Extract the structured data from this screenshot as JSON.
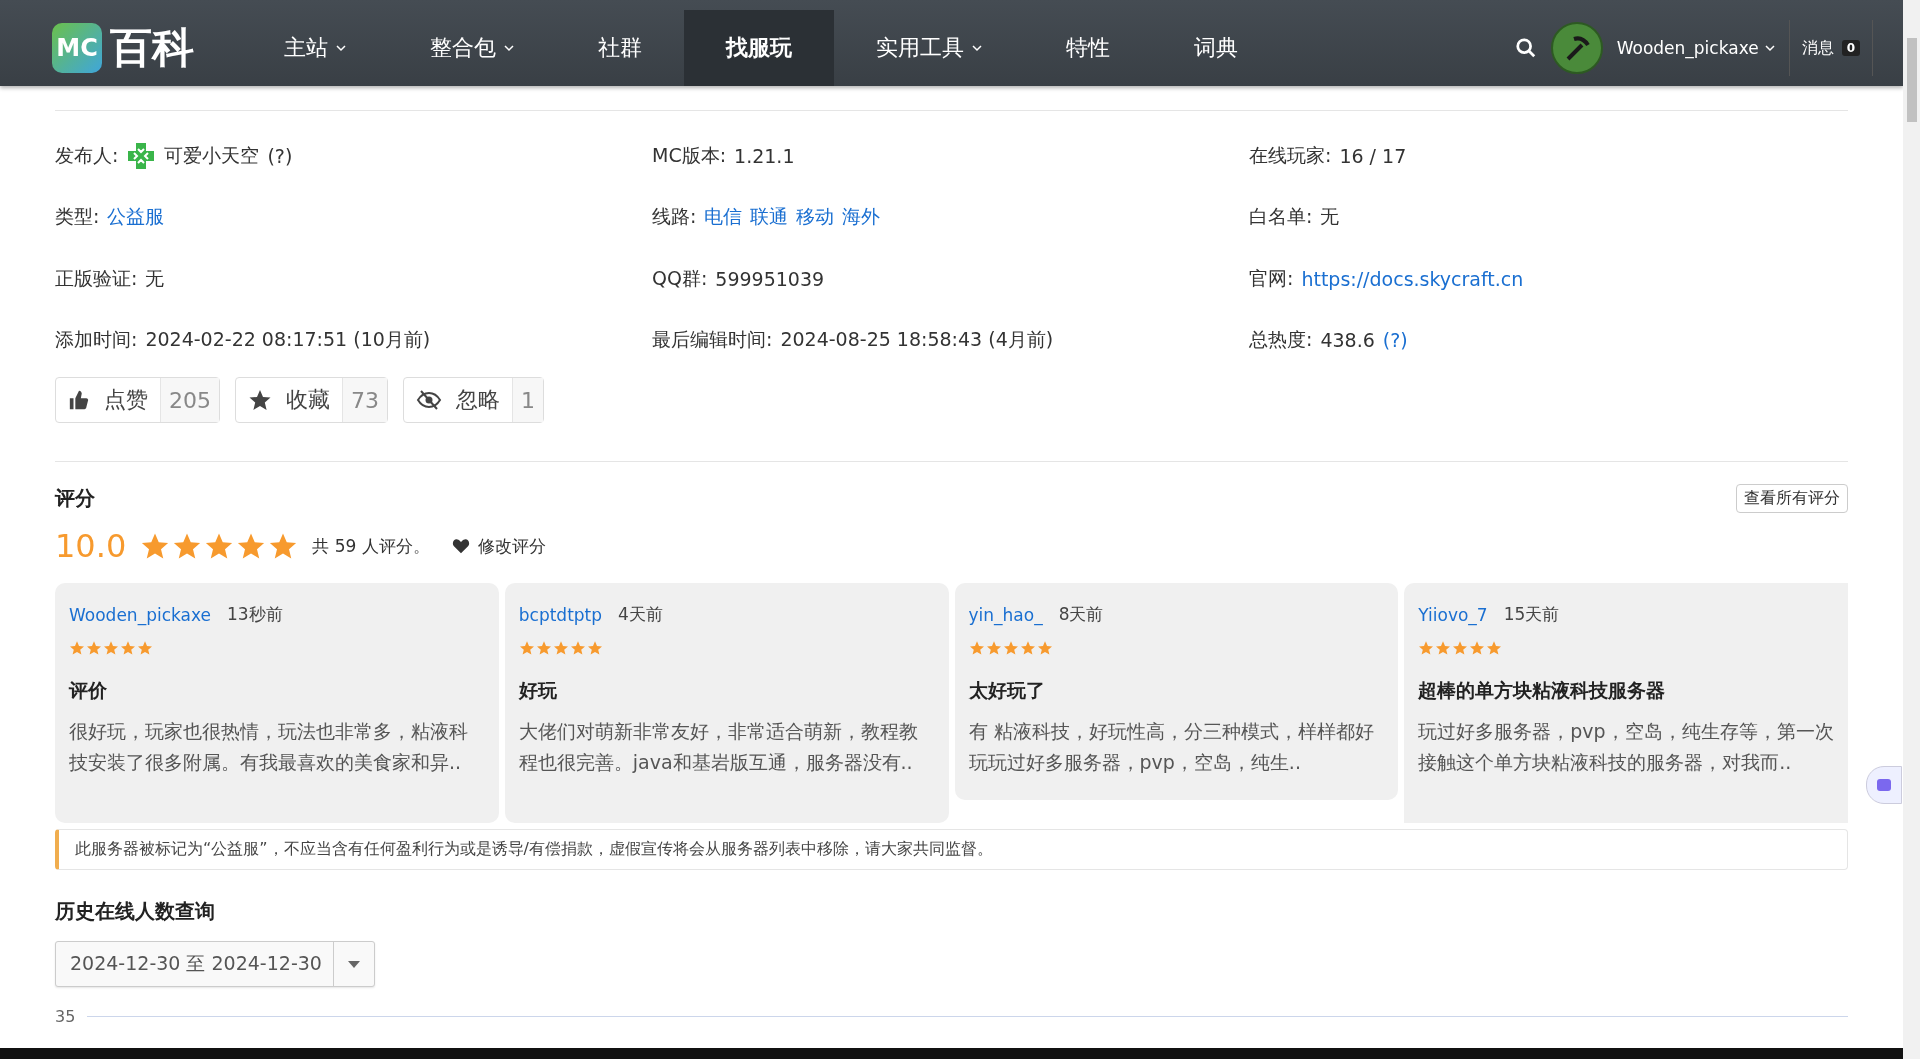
{
  "nav": {
    "logo_badge": "MC",
    "logo_text": "百科",
    "items": [
      {
        "label": "主站",
        "dropdown": true,
        "selected": false
      },
      {
        "label": "整合包",
        "dropdown": true,
        "selected": false
      },
      {
        "label": "社群",
        "dropdown": false,
        "selected": false
      },
      {
        "label": "找服玩",
        "dropdown": false,
        "selected": true
      },
      {
        "label": "实用工具",
        "dropdown": true,
        "selected": false
      },
      {
        "label": "特性",
        "dropdown": false,
        "selected": false
      },
      {
        "label": "词典",
        "dropdown": false,
        "selected": false
      }
    ],
    "user": "Wooden_pickaxe",
    "messages_label": "消息",
    "messages_count": "0"
  },
  "info": [
    {
      "label": "发布人:",
      "avatar": true,
      "parts": [
        {
          "text": "可爱小天空",
          "link": false
        },
        {
          "text": "(?)",
          "link": false
        }
      ]
    },
    {
      "label": "MC版本:",
      "parts": [
        {
          "text": "1.21.1",
          "link": false
        }
      ]
    },
    {
      "label": "在线玩家:",
      "parts": [
        {
          "text": "16 / 17",
          "link": false
        }
      ]
    },
    {
      "label": "类型:",
      "parts": [
        {
          "text": "公益服",
          "link": true
        }
      ]
    },
    {
      "label": "线路:",
      "parts": [
        {
          "text": "电信",
          "link": true
        },
        {
          "text": "联通",
          "link": true
        },
        {
          "text": "移动",
          "link": true
        },
        {
          "text": "海外",
          "link": true
        }
      ]
    },
    {
      "label": "白名单:",
      "parts": [
        {
          "text": "无",
          "link": false
        }
      ]
    },
    {
      "label": "正版验证:",
      "parts": [
        {
          "text": "无",
          "link": false
        }
      ]
    },
    {
      "label": "QQ群:",
      "parts": [
        {
          "text": "599951039",
          "link": false
        }
      ]
    },
    {
      "label": "官网:",
      "parts": [
        {
          "text": "https://docs.skycraft.cn",
          "link": true
        }
      ]
    },
    {
      "label": "添加时间:",
      "parts": [
        {
          "text": "2024-02-22 08:17:51 (10月前)",
          "link": false
        }
      ]
    },
    {
      "label": "最后编辑时间:",
      "parts": [
        {
          "text": "2024-08-25 18:58:43 (4月前)",
          "link": false
        }
      ]
    },
    {
      "label": "总热度:",
      "parts": [
        {
          "text": "438.6",
          "link": false
        },
        {
          "text": "(?)",
          "link": true
        }
      ]
    }
  ],
  "actions": [
    {
      "kind": "like",
      "label": "点赞",
      "count": "205"
    },
    {
      "kind": "favorite",
      "label": "收藏",
      "count": "73"
    },
    {
      "kind": "ignore",
      "label": "忽略",
      "count": "1"
    }
  ],
  "rating": {
    "title": "评分",
    "all_button": "查看所有评分",
    "score": "10.0",
    "stars": 5,
    "summary": "共 59 人评分。",
    "edit": "修改评分",
    "reviews": [
      {
        "user": "Wooden_pickaxe",
        "time": "13秒前",
        "stars": 5,
        "title": "评价",
        "body": "很好玩，玩家也很热情，玩法也非常多，粘液科技安装了很多附属。有我最喜欢的美食家和异.."
      },
      {
        "user": "bcptdtptp",
        "time": "4天前",
        "stars": 5,
        "title": "好玩",
        "body": "大佬们对萌新非常友好，非常适合萌新，教程教程也很完善。java和基岩版互通，服务器没有.."
      },
      {
        "user": "yin_hao_",
        "time": "8天前",
        "stars": 5,
        "title": "太好玩了",
        "body": " 有 粘液科技，好玩性高，分三种模式，样样都好玩玩过好多服务器，pvp，空岛，纯生.."
      },
      {
        "user": "Yiiovo_7",
        "time": "15天前",
        "stars": 5,
        "title": "超棒的单方块粘液科技服务器",
        "body": "玩过好多服务器，pvp，空岛，纯生存等，第一次接触这个单方块粘液科技的服务器，对我而.."
      }
    ]
  },
  "notice": "此服务器被标记为“公益服”，不应当含有任何盈利行为或是诱导/有偿捐款，虚假宣传将会从服务器列表中移除，请大家共同监督。",
  "history": {
    "title": "历史在线人数查询",
    "range": "2024-12-30 至 2024-12-30",
    "axis_label": "35"
  }
}
